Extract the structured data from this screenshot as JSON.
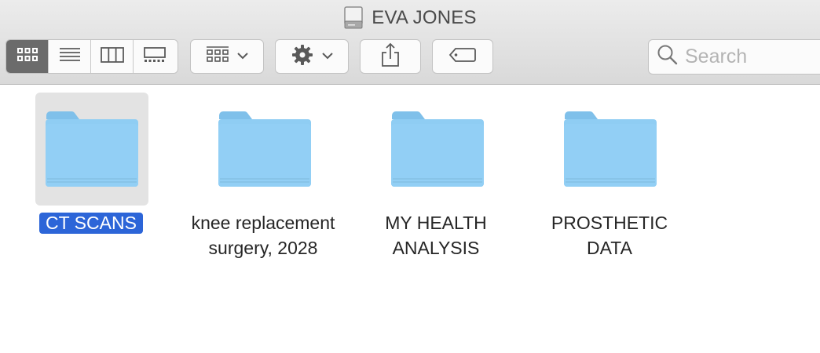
{
  "window": {
    "title": "EVA JONES",
    "title_icon": "external-drive-icon"
  },
  "toolbar": {
    "view_modes": [
      {
        "name": "icon-view",
        "icon": "grid-icon",
        "active": true
      },
      {
        "name": "list-view",
        "icon": "list-icon",
        "active": false
      },
      {
        "name": "column-view",
        "icon": "columns-icon",
        "active": false
      },
      {
        "name": "gallery-view",
        "icon": "gallery-icon",
        "active": false
      }
    ],
    "group_button_icon": "group-grid-icon",
    "action_button_icon": "gear-icon",
    "share_button_icon": "share-icon",
    "tag_button_icon": "tag-icon"
  },
  "search": {
    "placeholder": "Search",
    "value": "",
    "icon": "magnifier-icon"
  },
  "files": [
    {
      "name": "CT SCANS",
      "lines": [
        "CT SCANS"
      ],
      "selected": true,
      "icon": "folder-icon"
    },
    {
      "name": "knee replacement surgery, 2028",
      "lines": [
        "knee replacement",
        "surgery, 2028"
      ],
      "selected": false,
      "icon": "folder-icon"
    },
    {
      "name": "MY HEALTH ANALYSIS",
      "lines": [
        "MY HEALTH",
        "ANALYSIS"
      ],
      "selected": false,
      "icon": "folder-icon"
    },
    {
      "name": "PROSTHETIC DATA",
      "lines": [
        "PROSTHETIC",
        "DATA"
      ],
      "selected": false,
      "icon": "folder-icon"
    }
  ],
  "colors": {
    "selection": "#2c65d8",
    "folder": "#8fcdf3",
    "active_segment": "#6b6b6b"
  }
}
